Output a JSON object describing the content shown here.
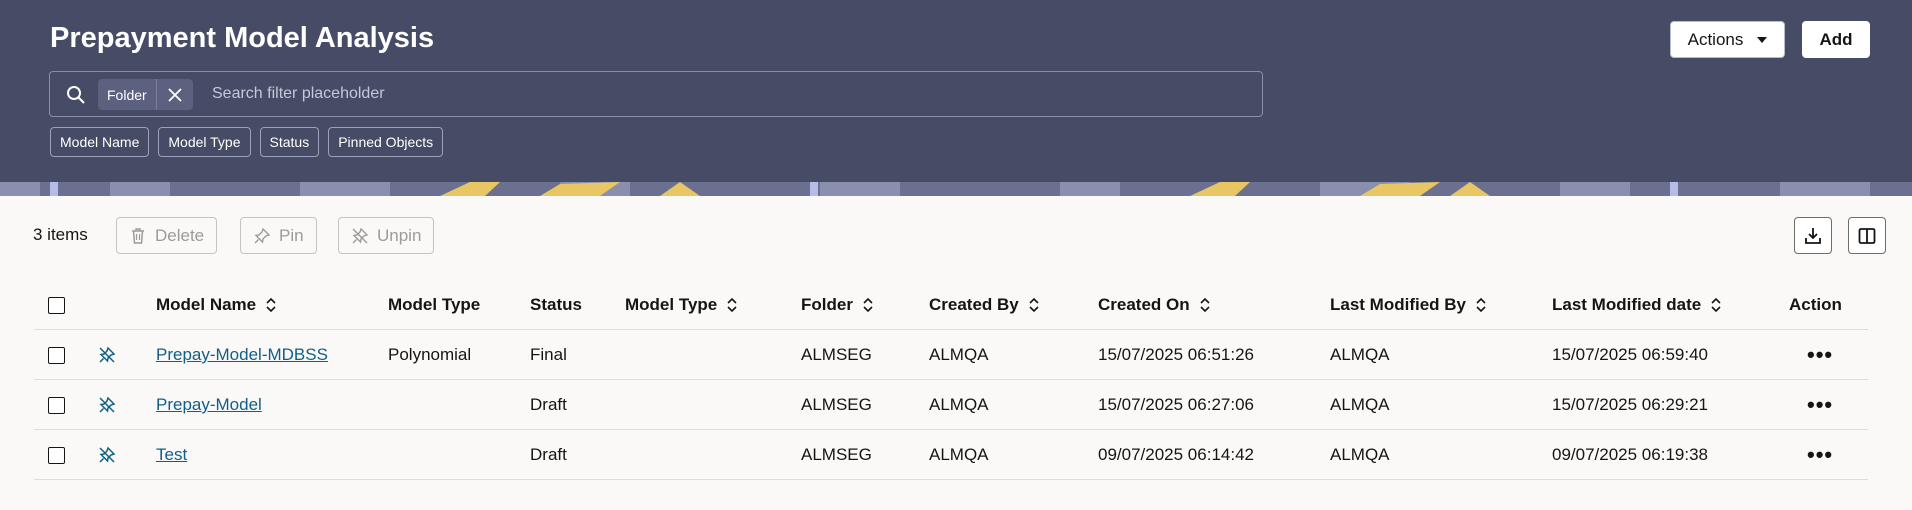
{
  "header": {
    "title": "Prepayment Model Analysis",
    "actions_label": "Actions",
    "add_label": "Add",
    "search": {
      "chip_label": "Folder",
      "placeholder": "Search filter placeholder"
    },
    "filters": [
      "Model Name",
      "Model Type",
      "Status",
      "Pinned Objects"
    ]
  },
  "toolbar": {
    "items_count": "3 items",
    "delete_label": "Delete",
    "pin_label": "Pin",
    "unpin_label": "Unpin"
  },
  "table": {
    "columns": [
      "Model Name",
      "Model Type",
      "Status",
      "Model Type",
      "Folder",
      "Created By",
      "Created On",
      "Last Modified By",
      "Last Modified date",
      "Action"
    ],
    "rows": [
      {
        "model_name": "Prepay-Model-MDBSS",
        "model_type": "Polynomial",
        "status": "Final",
        "model_type2": "",
        "folder": "ALMSEG",
        "created_by": "ALMQA",
        "created_on": "15/07/2025 06:51:26",
        "last_modified_by": "ALMQA",
        "last_modified_date": "15/07/2025 06:59:40",
        "action": "•••"
      },
      {
        "model_name": "Prepay-Model",
        "model_type": "",
        "status": "Draft",
        "model_type2": "",
        "folder": "ALMSEG",
        "created_by": "ALMQA",
        "created_on": "15/07/2025 06:27:06",
        "last_modified_by": "ALMQA",
        "last_modified_date": "15/07/2025 06:29:21",
        "action": "•••"
      },
      {
        "model_name": "Test",
        "model_type": "",
        "status": "Draft",
        "model_type2": "",
        "folder": "ALMSEG",
        "created_by": "ALMQA",
        "created_on": "09/07/2025 06:14:42",
        "last_modified_by": "ALMQA",
        "last_modified_date": "09/07/2025 06:19:38",
        "action": "•••"
      }
    ]
  },
  "icons": {
    "search": "search-icon",
    "close": "close-icon",
    "delete": "trash-icon",
    "pin": "pin-icon",
    "unpin": "unpin-icon",
    "download": "download-icon",
    "columns": "columns-icon",
    "sort": "sort-icon",
    "more": "ellipsis-icon"
  },
  "colors": {
    "header_bg": "#464b66",
    "link": "#0f5f8a",
    "page_bg": "#faf9f7"
  }
}
